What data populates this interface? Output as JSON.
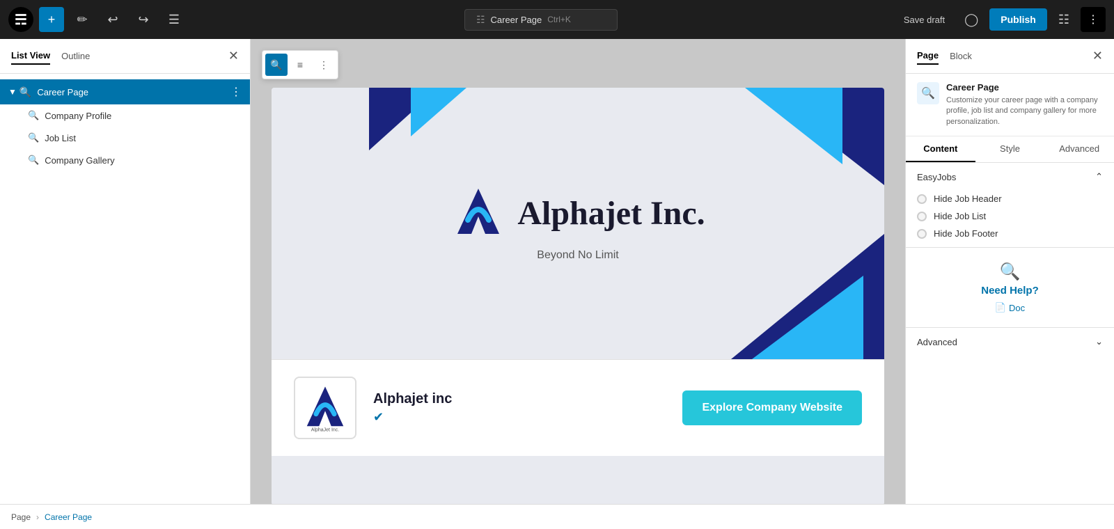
{
  "topbar": {
    "wp_logo": "W",
    "page_title": "Career Page",
    "keyboard_shortcut": "Ctrl+K",
    "save_draft_label": "Save draft",
    "publish_label": "Publish"
  },
  "left_sidebar": {
    "tab_list_view": "List View",
    "tab_outline": "Outline",
    "tree": {
      "root": {
        "label": "Career Page",
        "children": [
          {
            "label": "Company Profile"
          },
          {
            "label": "Job List"
          },
          {
            "label": "Company Gallery"
          }
        ]
      }
    }
  },
  "canvas": {
    "hero": {
      "company_name": "Alphajet Inc.",
      "tagline": "Beyond No Limit"
    },
    "profile": {
      "company_name": "Alphajet inc",
      "explore_btn": "Explore Company Website"
    }
  },
  "right_sidebar": {
    "tab_page": "Page",
    "tab_block": "Block",
    "block": {
      "title": "Career Page",
      "description": "Customize your career page with a company profile, job list and company gallery for more personalization."
    },
    "panel_tabs": {
      "content": "Content",
      "style": "Style",
      "advanced": "Advanced"
    },
    "easyjobs": {
      "section_title": "EasyJobs",
      "options": [
        {
          "label": "Hide Job Header"
        },
        {
          "label": "Hide Job List"
        },
        {
          "label": "Hide Job Footer"
        }
      ]
    },
    "need_help": {
      "title": "Need Help?",
      "doc_label": "Doc"
    },
    "advanced_section": {
      "label": "Advanced"
    }
  },
  "bottombar": {
    "page_label": "Page",
    "sep": "›",
    "current": "Career Page"
  }
}
